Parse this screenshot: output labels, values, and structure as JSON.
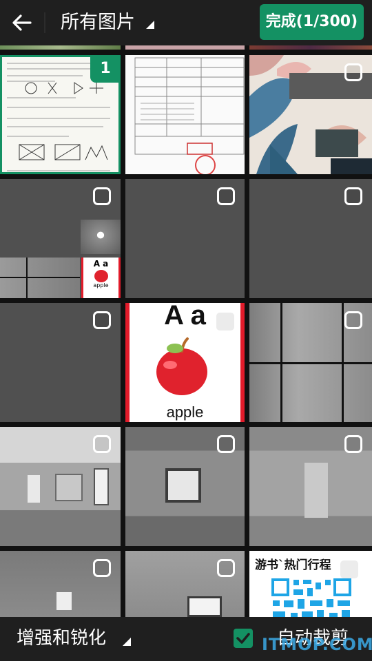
{
  "header": {
    "title": "所有图片",
    "done_label": "完成(1/300)"
  },
  "grid": {
    "selected_badge": "1",
    "card_letters": "A a",
    "card_word": "apple",
    "qr_heading": "游书`热门行程"
  },
  "footer": {
    "enhance_label": "增强和锐化",
    "autocrop_label": "自动裁剪",
    "autocrop_checked": true
  },
  "watermark": "ITMOP.COM",
  "colors": {
    "accent": "#149163",
    "topbar": "#1f1f1f",
    "tile_gray": "#505050"
  }
}
